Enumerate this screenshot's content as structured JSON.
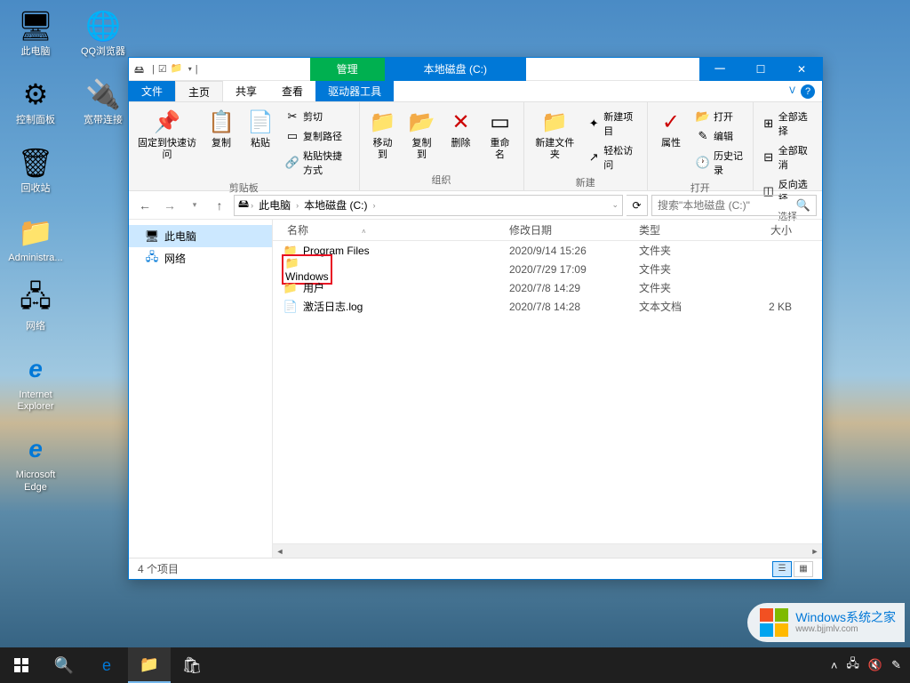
{
  "desktop": {
    "icons_col1": [
      {
        "label": "此电脑",
        "glyph": "computer"
      },
      {
        "label": "控制面板",
        "glyph": "control"
      },
      {
        "label": "回收站",
        "glyph": "recycle"
      },
      {
        "label": "Administra...",
        "glyph": "folder"
      },
      {
        "label": "网络",
        "glyph": "network"
      },
      {
        "label": "Internet Explorer",
        "glyph": "ie"
      },
      {
        "label": "Microsoft Edge",
        "glyph": "edge"
      }
    ],
    "icons_col2": [
      {
        "label": "QQ浏览器",
        "glyph": "qq"
      },
      {
        "label": "宽带连接",
        "glyph": "broadband"
      }
    ]
  },
  "window": {
    "title_mgmt": "管理",
    "title_drive": "本地磁盘 (C:)",
    "tabs": {
      "file": "文件",
      "home": "主页",
      "share": "共享",
      "view": "查看",
      "drive": "驱动器工具"
    },
    "ribbon": {
      "clipboard": {
        "label": "剪贴板",
        "pin": "固定到快速访问",
        "copy": "复制",
        "paste": "粘贴",
        "cut": "剪切",
        "copypath": "复制路径",
        "pasteshortcut": "粘贴快捷方式"
      },
      "organize": {
        "label": "组织",
        "moveto": "移动到",
        "copyto": "复制到",
        "delete": "删除",
        "rename": "重命名"
      },
      "new": {
        "label": "新建",
        "folder": "新建文件夹",
        "newitem": "新建项目",
        "easyaccess": "轻松访问"
      },
      "open": {
        "label": "打开",
        "properties": "属性",
        "open": "打开",
        "edit": "编辑",
        "history": "历史记录"
      },
      "select": {
        "label": "选择",
        "selectall": "全部选择",
        "selectnone": "全部取消",
        "invert": "反向选择"
      }
    },
    "breadcrumb": {
      "pc": "此电脑",
      "drive": "本地磁盘 (C:)"
    },
    "search_placeholder": "搜索\"本地磁盘 (C:)\"",
    "nav": {
      "pc": "此电脑",
      "network": "网络"
    },
    "columns": {
      "name": "名称",
      "date": "修改日期",
      "type": "类型",
      "size": "大小"
    },
    "files": [
      {
        "name": "Program Files",
        "date": "2020/9/14 15:26",
        "type": "文件夹",
        "size": "",
        "kind": "folder",
        "highlight": false
      },
      {
        "name": "Windows",
        "date": "2020/7/29 17:09",
        "type": "文件夹",
        "size": "",
        "kind": "folder",
        "highlight": true
      },
      {
        "name": "用户",
        "date": "2020/7/8 14:29",
        "type": "文件夹",
        "size": "",
        "kind": "folder",
        "highlight": false
      },
      {
        "name": "激活日志.log",
        "date": "2020/7/8 14:28",
        "type": "文本文档",
        "size": "2 KB",
        "kind": "file",
        "highlight": false
      }
    ],
    "status": "4 个项目"
  },
  "watermark": {
    "line1": "Windows系统之家",
    "line2": "www.bjjmlv.com"
  }
}
